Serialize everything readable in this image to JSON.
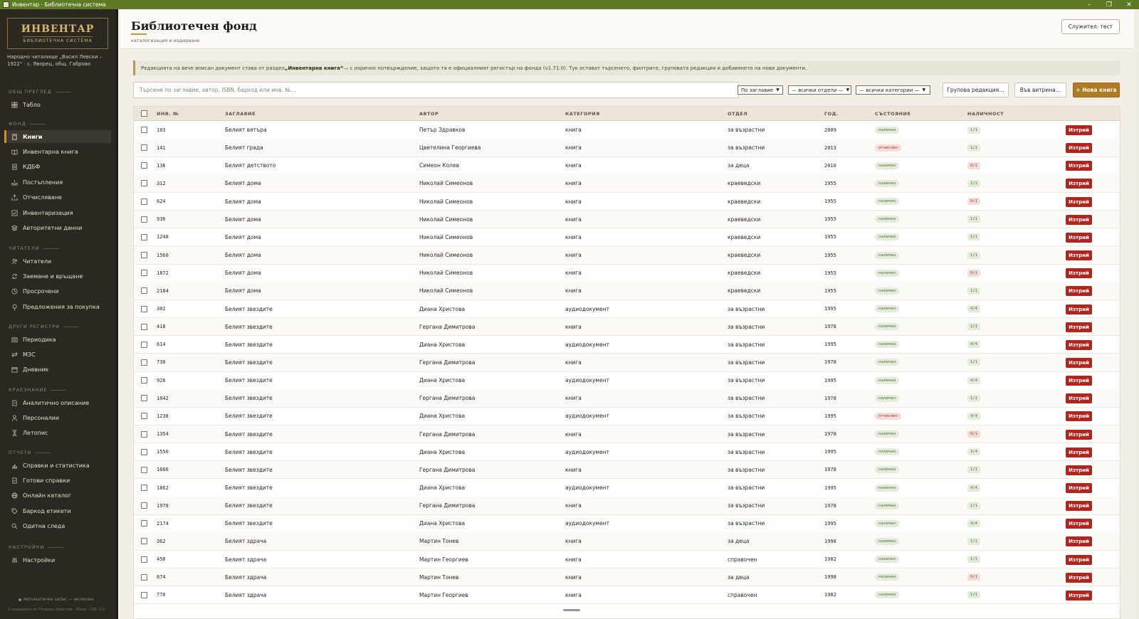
{
  "window": {
    "title": "Инвентар · Библиотечна система",
    "min": "–",
    "max": "❐",
    "close": "✕"
  },
  "sidebar": {
    "logo_title": "ИНВЕНТАР",
    "logo_subtitle": "БИБЛИОТЕЧНА СИСТЕМА",
    "org": "Народно читалище „Васил Левски – 1922“ · с. Яворец, общ. Габрово",
    "sections": [
      {
        "label": "ОБЩ ПРЕГЛЕД",
        "items": [
          {
            "label": "Табло",
            "icon": "dashboard-icon"
          }
        ]
      },
      {
        "label": "ФОНД",
        "items": [
          {
            "label": "Книги",
            "icon": "book-icon",
            "active": true
          },
          {
            "label": "Инвентарна книга",
            "icon": "open-book-icon"
          },
          {
            "label": "КДБФ",
            "icon": "ledger-icon"
          },
          {
            "label": "Постъпления",
            "icon": "inbox-icon"
          },
          {
            "label": "Отчисляване",
            "icon": "export-icon"
          },
          {
            "label": "Инвентаризация",
            "icon": "checklist-icon"
          },
          {
            "label": "Авторитетни данни",
            "icon": "layers-icon"
          }
        ]
      },
      {
        "label": "ЧИТАТЕЛИ",
        "items": [
          {
            "label": "Читатели",
            "icon": "users-icon"
          },
          {
            "label": "Заемане и връщане",
            "icon": "sync-icon"
          },
          {
            "label": "Просрочени",
            "icon": "clock-icon"
          },
          {
            "label": "Предложения за покупка",
            "icon": "lightbulb-icon"
          }
        ]
      },
      {
        "label": "ДРУГИ РЕГИСТРИ",
        "items": [
          {
            "label": "Периодика",
            "icon": "newspaper-icon"
          },
          {
            "label": "МЗС",
            "icon": "exchange-icon"
          },
          {
            "label": "Дневник",
            "icon": "calendar-icon"
          }
        ]
      },
      {
        "label": "КРАЕЗНАНИЕ",
        "items": [
          {
            "label": "Аналитично описание",
            "icon": "document-icon"
          },
          {
            "label": "Персоналии",
            "icon": "person-icon"
          },
          {
            "label": "Летопис",
            "icon": "hourglass-icon"
          }
        ]
      },
      {
        "label": "ОТЧЕТИ",
        "items": [
          {
            "label": "Справки и статистика",
            "icon": "bar-chart-icon"
          },
          {
            "label": "Готови справки",
            "icon": "report-icon"
          },
          {
            "label": "Онлайн каталог",
            "icon": "globe-icon"
          },
          {
            "label": "Баркод етикети",
            "icon": "tag-icon"
          },
          {
            "label": "Одитна следа",
            "icon": "magnifier-icon"
          }
        ]
      },
      {
        "label": "НАСТРОЙКИ",
        "items": [
          {
            "label": "Настройки",
            "icon": "sliders-icon"
          }
        ]
      }
    ],
    "autosave": "Автоматичен запис — включен",
    "credits": "Създадено от Пламен Христов · Пачо · GPL 3.0"
  },
  "header": {
    "title": "Библиотечен фонд",
    "subtitle": "каталогизация и издирване",
    "user_button": "Служител: тест"
  },
  "notice": {
    "before": "Редакцията на вече вписан документ става от раздел ",
    "bold": "„Инвентарна книга“",
    "after": " — с изрично потвърждение, защото тя е официалният регистър на фонда (v1.71.0). Тук остават търсенето, филтрите, груповата редакция и добавянето на нови документи."
  },
  "toolbar": {
    "search_placeholder": "Търсене по заглавие, автор, ISBN, баркод или инв. №…",
    "sort_select": "По заглавие",
    "dept_select": "— всички отдели —",
    "cat_select": "— всички категории —",
    "group_edit": "Групова редакция…",
    "showcase": "Във витрина…",
    "new_book": "+ Нова книга"
  },
  "table": {
    "columns": [
      "ИНВ. №",
      "ЗАГЛАВИЕ",
      "АВТОР",
      "КАТЕГОРИЯ",
      "ОТДЕЛ",
      "ГОД.",
      "СЪСТОЯНИЕ",
      "НАЛИЧНОСТ"
    ],
    "delete_label": "Изтрий",
    "rows": [
      {
        "inv": "103",
        "title": "Белият вятъра",
        "author": "Петър Здравков",
        "category": "книга",
        "dept": "за възрастни",
        "year": "2009",
        "status": "наличен",
        "status_kind": "ok",
        "avail": "1/1",
        "avail_kind": "ok"
      },
      {
        "inv": "141",
        "title": "Белият града",
        "author": "Цветелина Георгиева",
        "category": "книга",
        "dept": "за възрастни",
        "year": "2013",
        "status": "отчислен",
        "status_kind": "off",
        "avail": "1/1",
        "avail_kind": "ok"
      },
      {
        "inv": "136",
        "title": "Белият детството",
        "author": "Симеон Колев",
        "category": "книга",
        "dept": "за деца",
        "year": "2010",
        "status": "наличен",
        "status_kind": "ok",
        "avail": "0/1",
        "avail_kind": "zero"
      },
      {
        "inv": "312",
        "title": "Белият дома",
        "author": "Николай Симеонов",
        "category": "книга",
        "dept": "краеведски",
        "year": "1955",
        "status": "наличен",
        "status_kind": "ok",
        "avail": "1/1",
        "avail_kind": "ok"
      },
      {
        "inv": "624",
        "title": "Белият дома",
        "author": "Николай Симеонов",
        "category": "книга",
        "dept": "краеведски",
        "year": "1955",
        "status": "наличен",
        "status_kind": "ok",
        "avail": "0/1",
        "avail_kind": "zero"
      },
      {
        "inv": "936",
        "title": "Белият дома",
        "author": "Николай Симеонов",
        "category": "книга",
        "dept": "краеведски",
        "year": "1955",
        "status": "наличен",
        "status_kind": "ok",
        "avail": "1/1",
        "avail_kind": "ok"
      },
      {
        "inv": "1248",
        "title": "Белият дома",
        "author": "Николай Симеонов",
        "category": "книга",
        "dept": "краеведски",
        "year": "1955",
        "status": "наличен",
        "status_kind": "ok",
        "avail": "1/1",
        "avail_kind": "ok"
      },
      {
        "inv": "1560",
        "title": "Белият дома",
        "author": "Николай Симеонов",
        "category": "книга",
        "dept": "краеведски",
        "year": "1955",
        "status": "наличен",
        "status_kind": "ok",
        "avail": "1/1",
        "avail_kind": "ok"
      },
      {
        "inv": "1872",
        "title": "Белият дома",
        "author": "Николай Симеонов",
        "category": "книга",
        "dept": "краеведски",
        "year": "1955",
        "status": "наличен",
        "status_kind": "ok",
        "avail": "0/1",
        "avail_kind": "zero"
      },
      {
        "inv": "2184",
        "title": "Белият дома",
        "author": "Николай Симеонов",
        "category": "книга",
        "dept": "краеведски",
        "year": "1955",
        "status": "наличен",
        "status_kind": "ok",
        "avail": "1/1",
        "avail_kind": "ok"
      },
      {
        "inv": "302",
        "title": "Белият звездите",
        "author": "Диана Христова",
        "category": "аудиодокумент",
        "dept": "за възрастни",
        "year": "1995",
        "status": "наличен",
        "status_kind": "ok",
        "avail": "4/4",
        "avail_kind": "ok"
      },
      {
        "inv": "418",
        "title": "Белият звездите",
        "author": "Гергана Димитрова",
        "category": "книга",
        "dept": "за възрастни",
        "year": "1978",
        "status": "наличен",
        "status_kind": "ok",
        "avail": "1/1",
        "avail_kind": "ok"
      },
      {
        "inv": "614",
        "title": "Белият звездите",
        "author": "Диана Христова",
        "category": "аудиодокумент",
        "dept": "за възрастни",
        "year": "1995",
        "status": "наличен",
        "status_kind": "ok",
        "avail": "4/4",
        "avail_kind": "ok"
      },
      {
        "inv": "730",
        "title": "Белият звездите",
        "author": "Гергана Димитрова",
        "category": "книга",
        "dept": "за възрастни",
        "year": "1978",
        "status": "наличен",
        "status_kind": "ok",
        "avail": "1/1",
        "avail_kind": "ok"
      },
      {
        "inv": "926",
        "title": "Белият звездите",
        "author": "Диана Христова",
        "category": "аудиодокумент",
        "dept": "за възрастни",
        "year": "1995",
        "status": "наличен",
        "status_kind": "ok",
        "avail": "4/4",
        "avail_kind": "ok"
      },
      {
        "inv": "1042",
        "title": "Белият звездите",
        "author": "Гергана Димитрова",
        "category": "книга",
        "dept": "за възрастни",
        "year": "1978",
        "status": "наличен",
        "status_kind": "ok",
        "avail": "1/1",
        "avail_kind": "ok"
      },
      {
        "inv": "1238",
        "title": "Белият звездите",
        "author": "Диана Христова",
        "category": "аудиодокумент",
        "dept": "за възрастни",
        "year": "1995",
        "status": "отчислен",
        "status_kind": "off",
        "avail": "4/4",
        "avail_kind": "ok"
      },
      {
        "inv": "1354",
        "title": "Белият звездите",
        "author": "Гергана Димитрова",
        "category": "книга",
        "dept": "за възрастни",
        "year": "1978",
        "status": "наличен",
        "status_kind": "ok",
        "avail": "0/1",
        "avail_kind": "zero"
      },
      {
        "inv": "1550",
        "title": "Белият звездите",
        "author": "Диана Христова",
        "category": "аудиодокумент",
        "dept": "за възрастни",
        "year": "1995",
        "status": "наличен",
        "status_kind": "ok",
        "avail": "3/4",
        "avail_kind": "ok"
      },
      {
        "inv": "1666",
        "title": "Белият звездите",
        "author": "Гергана Димитрова",
        "category": "книга",
        "dept": "за възрастни",
        "year": "1978",
        "status": "наличен",
        "status_kind": "ok",
        "avail": "1/1",
        "avail_kind": "ok"
      },
      {
        "inv": "1862",
        "title": "Белият звездите",
        "author": "Диана Христова",
        "category": "аудиодокумент",
        "dept": "за възрастни",
        "year": "1995",
        "status": "наличен",
        "status_kind": "ok",
        "avail": "4/4",
        "avail_kind": "ok"
      },
      {
        "inv": "1978",
        "title": "Белият звездите",
        "author": "Гергана Димитрова",
        "category": "книга",
        "dept": "за възрастни",
        "year": "1978",
        "status": "наличен",
        "status_kind": "ok",
        "avail": "1/1",
        "avail_kind": "ok"
      },
      {
        "inv": "2174",
        "title": "Белият звездите",
        "author": "Диана Христова",
        "category": "аудиодокумент",
        "dept": "за възрастни",
        "year": "1995",
        "status": "наличен",
        "status_kind": "ok",
        "avail": "4/4",
        "avail_kind": "ok"
      },
      {
        "inv": "362",
        "title": "Белият здрача",
        "author": "Мартин Тонев",
        "category": "книга",
        "dept": "за деца",
        "year": "1998",
        "status": "наличен",
        "status_kind": "ok",
        "avail": "1/1",
        "avail_kind": "ok"
      },
      {
        "inv": "458",
        "title": "Белият здрача",
        "author": "Мартин Георгиев",
        "category": "книга",
        "dept": "справочен",
        "year": "1982",
        "status": "наличен",
        "status_kind": "ok",
        "avail": "1/1",
        "avail_kind": "ok"
      },
      {
        "inv": "674",
        "title": "Белият здрача",
        "author": "Мартин Тонев",
        "category": "книга",
        "dept": "за деца",
        "year": "1998",
        "status": "наличен",
        "status_kind": "ok",
        "avail": "0/1",
        "avail_kind": "zero"
      },
      {
        "inv": "770",
        "title": "Белият здрача",
        "author": "Мартин Георгиев",
        "category": "книга",
        "dept": "справочен",
        "year": "1982",
        "status": "наличен",
        "status_kind": "ok",
        "avail": "1/1",
        "avail_kind": "ok"
      }
    ]
  }
}
